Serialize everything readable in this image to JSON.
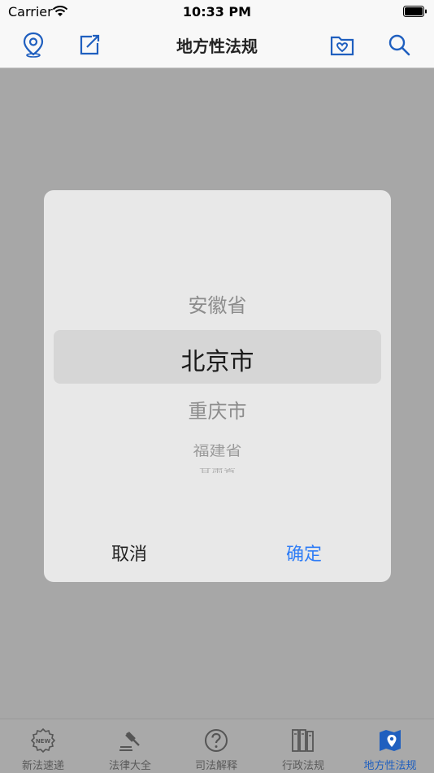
{
  "status_bar": {
    "carrier": "Carrier",
    "time": "10:33 PM"
  },
  "navbar": {
    "title": "地方性法规",
    "icons": [
      "location-pin-icon",
      "share-icon",
      "favorites-folder-icon",
      "search-icon"
    ]
  },
  "picker": {
    "items": [
      "安徽省",
      "北京市",
      "重庆市",
      "福建省",
      "甘肃省"
    ],
    "selected": "北京市"
  },
  "dialog": {
    "cancel_label": "取消",
    "confirm_label": "确定"
  },
  "tabbar": {
    "tabs": [
      {
        "label": "新法速递",
        "icon": "new-badge-icon"
      },
      {
        "label": "法律大全",
        "icon": "gavel-icon"
      },
      {
        "label": "司法解释",
        "icon": "question-circle-icon"
      },
      {
        "label": "行政法规",
        "icon": "books-icon"
      },
      {
        "label": "地方性法规",
        "icon": "map-pin-icon"
      }
    ],
    "active": "地方性法规"
  },
  "colors": {
    "accent": "#2f7df6",
    "nav_icon": "#1f5fbf",
    "overlay": "#a7a7a7"
  }
}
